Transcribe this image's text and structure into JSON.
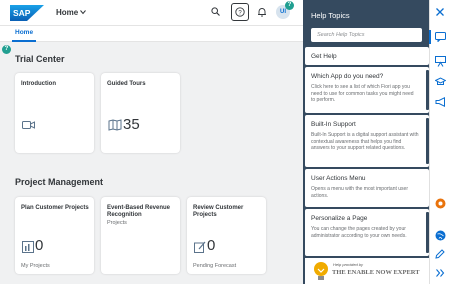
{
  "shell": {
    "app_title": "Home",
    "user_initials": "UI",
    "badge": "?",
    "left_badge": "?"
  },
  "tabs": [
    {
      "label": "Home"
    }
  ],
  "sections": [
    {
      "title": "Trial Center",
      "tiles": [
        {
          "title": "Introduction",
          "subtitle": "",
          "number": "",
          "footer": ""
        },
        {
          "title": "Guided Tours",
          "subtitle": "",
          "number": "35",
          "footer": ""
        }
      ]
    },
    {
      "title": "Project Management",
      "tiles": [
        {
          "title": "Plan Customer Projects",
          "subtitle": "",
          "number": "0",
          "footer": "My Projects"
        },
        {
          "title": "Event-Based Revenue Recognition",
          "subtitle": "Projects",
          "number": "",
          "footer": ""
        },
        {
          "title": "Review Customer Projects",
          "subtitle": "",
          "number": "0",
          "footer": "Pending Forecast"
        }
      ]
    }
  ],
  "help_panel": {
    "title": "Help Topics",
    "search_placeholder": "Search Help Topics",
    "items": [
      {
        "title": "Get Help",
        "desc": ""
      },
      {
        "title": "Which App do you need?",
        "desc": "Click here to see a list of which Fiori app you need to use for common tasks you might need to perform."
      },
      {
        "title": "Built-In Support",
        "desc": "Built-In Support is a digital support assistant with contextual awareness that helps you find answers to your support related questions."
      },
      {
        "title": "User Actions Menu",
        "desc": "Opens a menu with the most important user actions."
      },
      {
        "title": "Personalize a Page",
        "desc": "You can change the pages created by your administrator according to your own needs."
      }
    ],
    "credit_by": "Help provided by",
    "credit_name": "THE ENABLE NOW EXPERT"
  },
  "colors": {
    "accent": "#0a6ed1",
    "panel_bg": "#354a5f",
    "teal_badge": "#219f91",
    "orange": "#e9730c"
  }
}
